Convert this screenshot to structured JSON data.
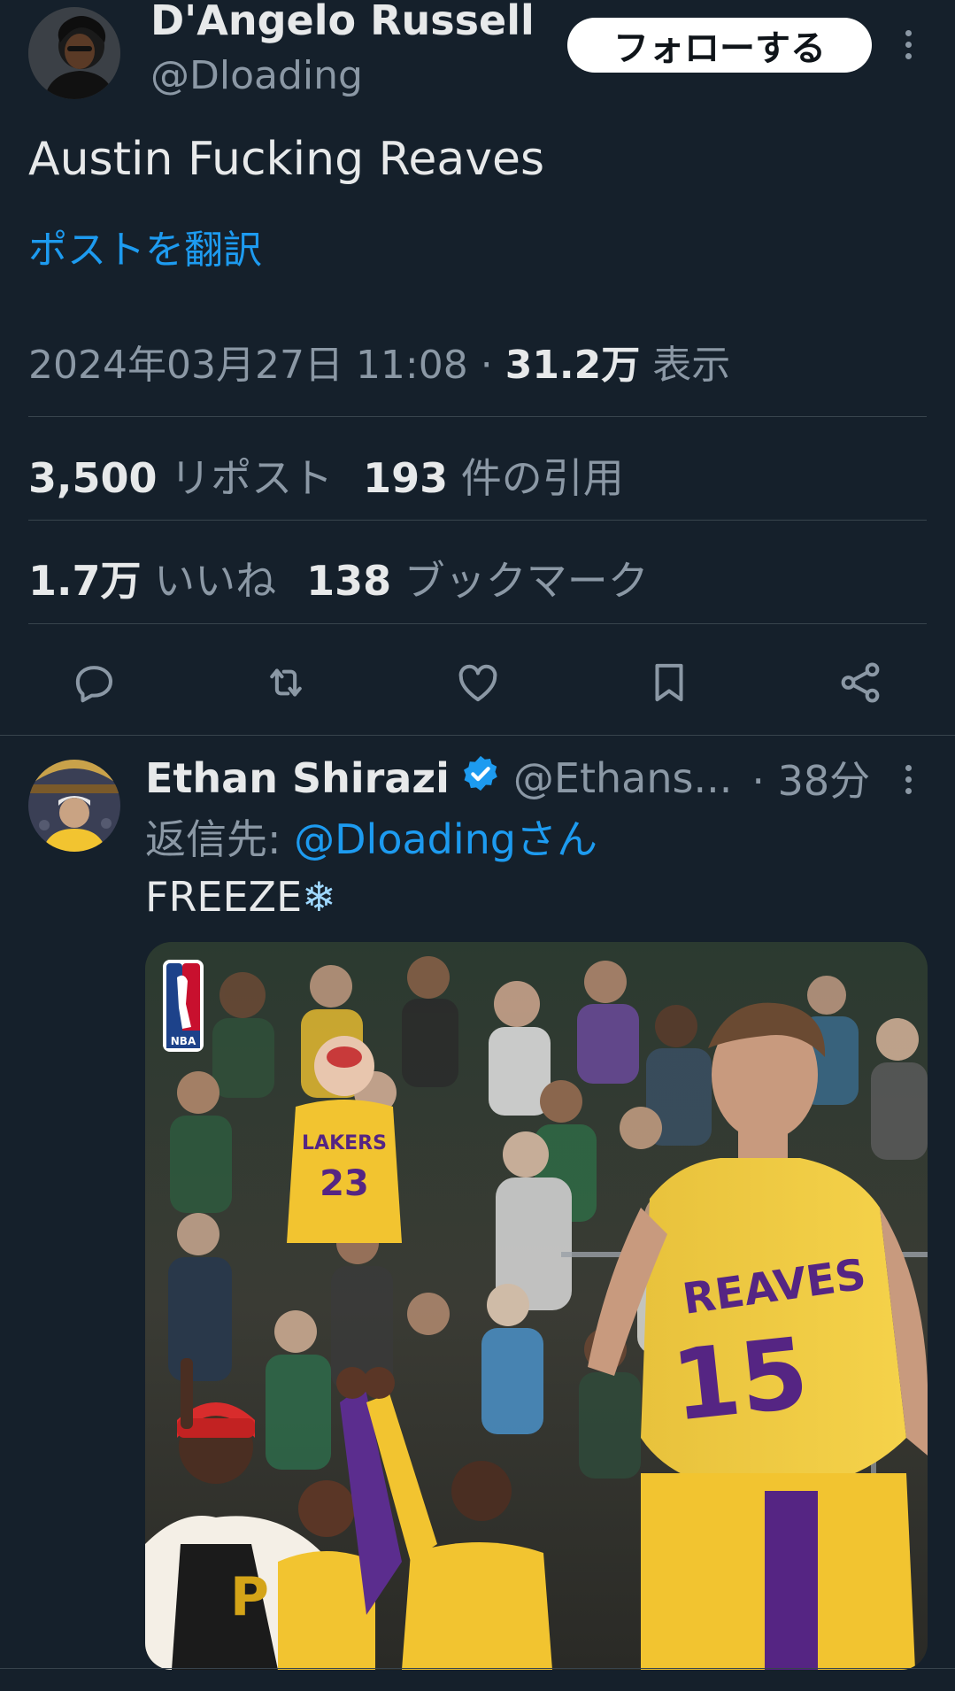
{
  "tweet": {
    "author_name": "D'Angelo Russell",
    "author_handle": "@Dloading",
    "follow_label": "フォローする",
    "text": "Austin Fucking Reaves",
    "translate_label": "ポストを翻訳",
    "timestamp": "2024年03月27日 11:08 · ",
    "views_count": "31.2万",
    "views_label": "表示",
    "reposts_count": "3,500",
    "reposts_label": "リポスト",
    "quotes_count": "193",
    "quotes_label": "件の引用",
    "likes_count": "1.7万",
    "likes_label": "いいね",
    "bookmarks_count": "138",
    "bookmarks_label": "ブックマーク"
  },
  "reply": {
    "author_name": "Ethan Shirazi",
    "author_handle": "@Ethans...",
    "time": "· 38分",
    "reply_to_prefix": "返信先: ",
    "reply_to_handle": "@Dloadingさん",
    "text": "FREEZE",
    "emoji": "❄",
    "photo_texts": {
      "logo": "NBA",
      "fan_jersey_brand": "LAKERS",
      "fan_jersey_number": "23",
      "player_name": "REAVES",
      "player_number": "15"
    }
  },
  "icons": {
    "reply": "reply-icon",
    "repost": "repost-icon",
    "like": "heart-icon",
    "bookmark": "bookmark-icon",
    "share": "share-icon",
    "more": "more-icon",
    "verified": "verified-badge-icon"
  },
  "colors": {
    "background": "#15202b",
    "accent": "#1d9bf0",
    "muted": "#8b98a5",
    "laker_gold": "#f2c430",
    "laker_purple": "#552583"
  }
}
